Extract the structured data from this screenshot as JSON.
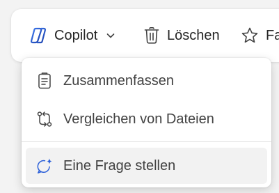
{
  "toolbar": {
    "copilot_label": "Copilot",
    "delete_label": "Löschen",
    "favorite_label": "Fa",
    "icons": {
      "copilot": "copilot-icon",
      "dropdown": "chevron-down-icon",
      "delete": "trash-icon",
      "favorite": "star-icon"
    }
  },
  "menu": {
    "items": [
      {
        "label": "Zusammenfassen",
        "icon": "summary-icon"
      },
      {
        "label": "Vergleichen von Dateien",
        "icon": "compare-files-icon"
      },
      {
        "label": "Eine Frage stellen",
        "icon": "ask-question-icon"
      }
    ],
    "highlighted_index": 2
  },
  "colors": {
    "background": "#f3f3f3",
    "surface": "#ffffff",
    "text": "#242424",
    "menu_text": "#424242",
    "hover": "#f2f2f2",
    "copilot_accent": "#2b5fd9"
  }
}
